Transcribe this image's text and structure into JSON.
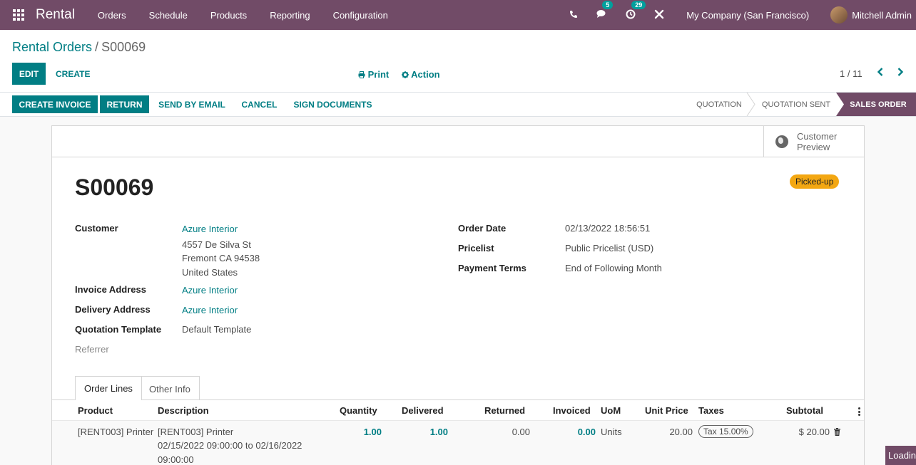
{
  "navbar": {
    "app_name": "Rental",
    "menu": [
      "Orders",
      "Schedule",
      "Products",
      "Reporting",
      "Configuration"
    ],
    "messages_badge": "5",
    "activities_badge": "29",
    "company": "My Company (San Francisco)",
    "user": "Mitchell Admin"
  },
  "control_panel": {
    "breadcrumb_parent": "Rental Orders",
    "breadcrumb_sep": "/",
    "breadcrumb_current": "S00069",
    "edit_label": "EDIT",
    "create_label": "CREATE",
    "print_label": "Print",
    "action_label": "Action",
    "pager": "1 / 11"
  },
  "statusbar": {
    "buttons": [
      "CREATE INVOICE",
      "RETURN",
      "SEND BY EMAIL",
      "CANCEL",
      "SIGN DOCUMENTS"
    ],
    "stages": [
      "QUOTATION",
      "QUOTATION SENT",
      "SALES ORDER"
    ],
    "active_stage": "SALES ORDER"
  },
  "sheet": {
    "preview_label": "Customer Preview",
    "ribbon": "Picked-up",
    "title": "S00069",
    "left_fields": {
      "customer_label": "Customer",
      "customer_name": "Azure Interior",
      "address_line1": "4557 De Silva St",
      "address_line2": "Fremont CA 94538",
      "address_line3": "United States",
      "invoice_address_label": "Invoice Address",
      "invoice_address": "Azure Interior",
      "delivery_address_label": "Delivery Address",
      "delivery_address": "Azure Interior",
      "quotation_template_label": "Quotation Template",
      "quotation_template": "Default Template",
      "referrer_label": "Referrer"
    },
    "right_fields": {
      "order_date_label": "Order Date",
      "order_date": "02/13/2022 18:56:51",
      "pricelist_label": "Pricelist",
      "pricelist": "Public Pricelist (USD)",
      "payment_terms_label": "Payment Terms",
      "payment_terms": "End of Following Month"
    },
    "tabs": [
      "Order Lines",
      "Other Info"
    ],
    "columns": [
      "Product",
      "Description",
      "Quantity",
      "Delivered",
      "Returned",
      "Invoiced",
      "UoM",
      "Unit Price",
      "Taxes",
      "Subtotal"
    ],
    "lines": [
      {
        "product": "[RENT003] Printer",
        "description_line1": "[RENT003] Printer",
        "description_line2": "02/15/2022 09:00:00 to 02/16/2022",
        "description_line3": "09:00:00",
        "quantity": "1.00",
        "delivered": "1.00",
        "returned": "0.00",
        "invoiced": "0.00",
        "uom": "Units",
        "unit_price": "20.00",
        "tax": "Tax 15.00%",
        "subtotal": "$ 20.00"
      }
    ]
  },
  "loading_label": "Loading"
}
